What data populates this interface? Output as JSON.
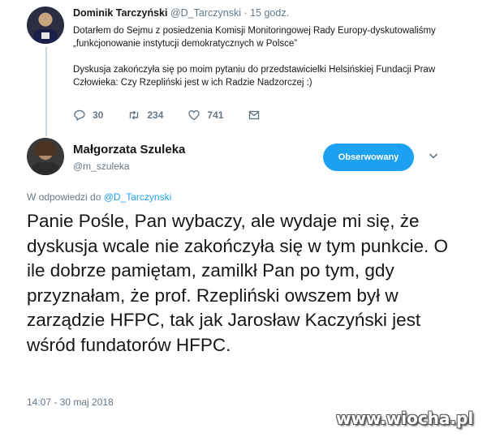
{
  "parent_tweet": {
    "author_name": "Dominik Tarczyński",
    "author_handle": "@D_Tarczynski",
    "time": " · 15 godz.",
    "text_paragraph_1": "Dotarłem do Sejmu z posiedzenia Komisji Monitoringowej Rady Europy-dyskutowaliśmy „funkcjonowanie instytucji demokratycznych w Polsce”",
    "text_paragraph_2": "Dyskusja zakończyła się po moim pytaniu do przedstawicielki Helsińskiej Fundacji Praw Człowieka: Czy Rzepliński jest w ich Radzie Nadzorczej :)",
    "replies": "30",
    "retweets": "234",
    "likes": "741",
    "icons": [
      "reply-icon",
      "retweet-icon",
      "heart-icon",
      "message-icon"
    ]
  },
  "reply_tweet": {
    "author_name": "Małgorzata Szuleka",
    "author_handle": "@m_szuleka",
    "follow_label": "Obserwowany",
    "reply_to_prefix": "W odpowiedzi do ",
    "reply_to_handle": "@D_Tarczynski",
    "text": "Panie Pośle, Pan wybaczy, ale wydaje mi się, że dyskusja wcale nie zakończyła się w tym punkcie. O ile dobrze pamiętam, zamilkł Pan po tym, gdy przyznałam, że prof. Rzepliński owszem był w zarządzie HFPC, tak jak Jarosław Kaczyński jest wśród fundatorów HFPC.",
    "timestamp": "14:07 - 30 maj 2018"
  },
  "watermark": "www.wiocha.pl",
  "colors": {
    "accent": "#1da1f2",
    "muted": "#657786",
    "text": "#14171a",
    "thread_line": "#ccd6dd"
  }
}
